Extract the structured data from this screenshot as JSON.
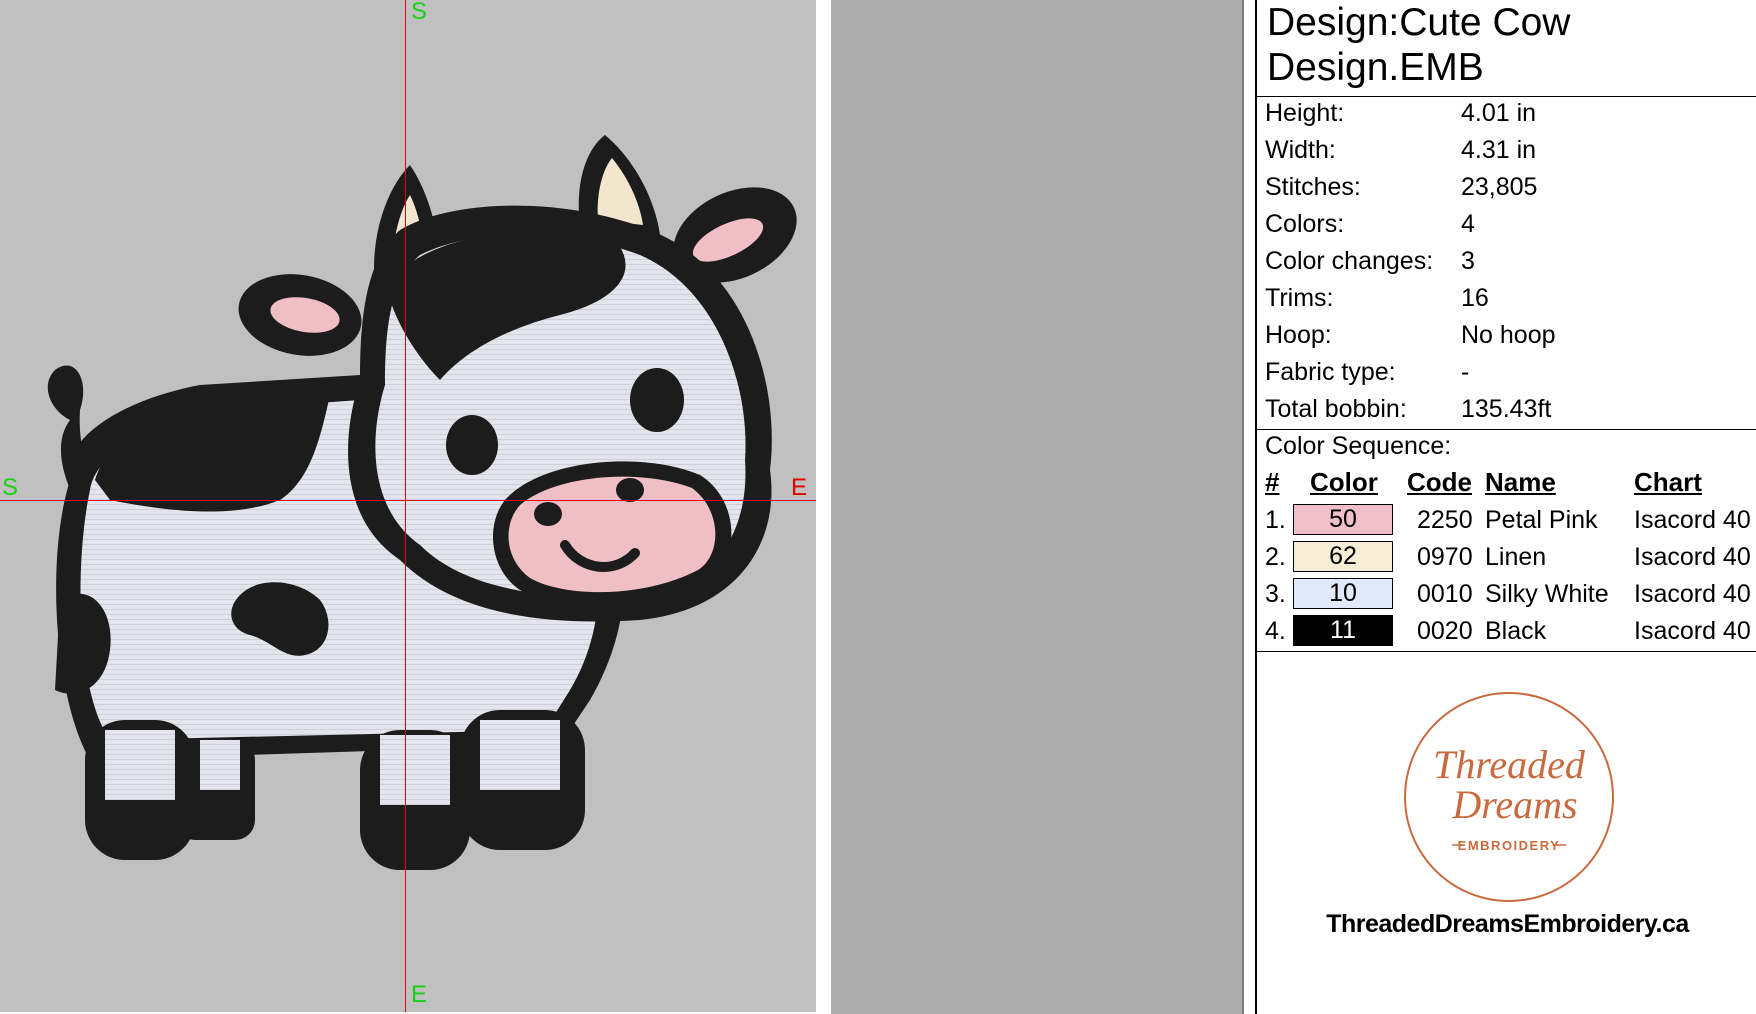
{
  "canvas": {
    "markers": {
      "top": "S",
      "bottom": "E",
      "left": "S",
      "right": "E"
    },
    "colors": {
      "background": "#c0c0c0",
      "guide": "#e00000",
      "marker": "#18d018",
      "black_fill": "#1c1c1c",
      "white_fill": "#e4e4ec",
      "pink_fill": "#f0bfc6",
      "linen_fill": "#f2e6cf"
    }
  },
  "info": {
    "title_line1": "Design:Cute Cow",
    "title_line2": "Design.EMB",
    "stats": [
      {
        "label": "Height:",
        "value": "4.01 in"
      },
      {
        "label": "Width:",
        "value": "4.31 in"
      },
      {
        "label": "Stitches:",
        "value": "23,805"
      },
      {
        "label": "Colors:",
        "value": "4"
      },
      {
        "label": "Color changes:",
        "value": "3"
      },
      {
        "label": "Trims:",
        "value": "16"
      },
      {
        "label": "Hoop:",
        "value": "No hoop"
      },
      {
        "label": "Fabric type:",
        "value": "-"
      },
      {
        "label": "Total bobbin:",
        "value": "135.43ft"
      }
    ],
    "sequence_title": "Color Sequence:",
    "headers": {
      "num": "#",
      "color": "Color",
      "code": "Code",
      "name": "Name",
      "chart": "Chart"
    },
    "colors": [
      {
        "num": "1.",
        "swatch": "50",
        "code": "2250",
        "name": "Petal Pink",
        "chart": "Isacord 40",
        "hex": "#f0bfc9",
        "text_color": "#000000"
      },
      {
        "num": "2.",
        "swatch": "62",
        "code": "0970",
        "name": "Linen",
        "chart": "Isacord 40",
        "hex": "#f6edd6",
        "text_color": "#000000"
      },
      {
        "num": "3.",
        "swatch": "10",
        "code": "0010",
        "name": "Silky White",
        "chart": "Isacord 40",
        "hex": "#e1e9fb",
        "text_color": "#000000"
      },
      {
        "num": "4.",
        "swatch": "11",
        "code": "0020",
        "name": "Black",
        "chart": "Isacord 40",
        "hex": "#000000",
        "text_color": "#ffffff"
      }
    ],
    "logo": {
      "line1": "Threaded",
      "line2": "Dreams",
      "line3": "EMBROIDERY",
      "color": "#c96a3e"
    },
    "website": "ThreadedDreamsEmbroidery.ca"
  }
}
